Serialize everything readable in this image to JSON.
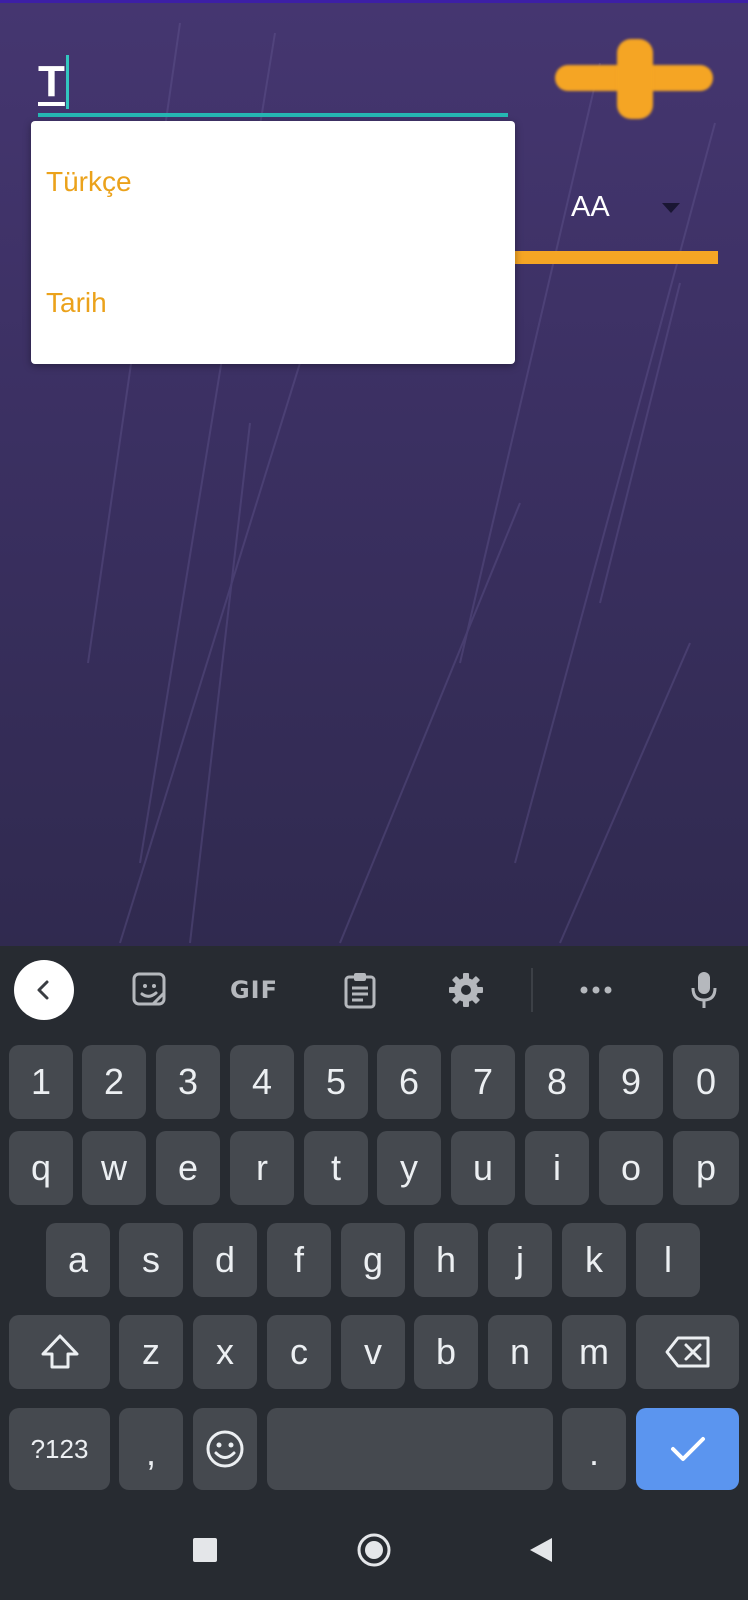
{
  "app": {
    "text_input": {
      "value": "T"
    },
    "add_button": {
      "icon": "plus-icon",
      "color": "#f5a524"
    },
    "spinner": {
      "value": "AA"
    },
    "dropdown": {
      "items": [
        "Türkçe",
        "Tarih"
      ]
    },
    "colors": {
      "accent": "#f5a524",
      "input_underline": "#26b8b4",
      "background": "#3b3062",
      "dropdown_text": "#eba21b"
    }
  },
  "keyboard": {
    "toolbar": {
      "back": "chevron-left-icon",
      "sticker": "sticker-icon",
      "gif": "GIF",
      "clipboard": "clipboard-icon",
      "settings": "gear-icon",
      "more": "more-icon",
      "mic": "microphone-icon"
    },
    "rows": {
      "numbers": [
        "1",
        "2",
        "3",
        "4",
        "5",
        "6",
        "7",
        "8",
        "9",
        "0"
      ],
      "row1": [
        "q",
        "w",
        "e",
        "r",
        "t",
        "y",
        "u",
        "i",
        "o",
        "p"
      ],
      "row2": [
        "a",
        "s",
        "d",
        "f",
        "g",
        "h",
        "j",
        "k",
        "l"
      ],
      "row3": [
        "z",
        "x",
        "c",
        "v",
        "b",
        "n",
        "m"
      ]
    },
    "symbols_key": "?123",
    "comma_key": ",",
    "period_key": ".",
    "enter_icon": "check-icon",
    "enter_color": "#5b95ef"
  },
  "navigation": {
    "recents": "square-icon",
    "home": "circle-icon",
    "back": "triangle-back-icon"
  }
}
